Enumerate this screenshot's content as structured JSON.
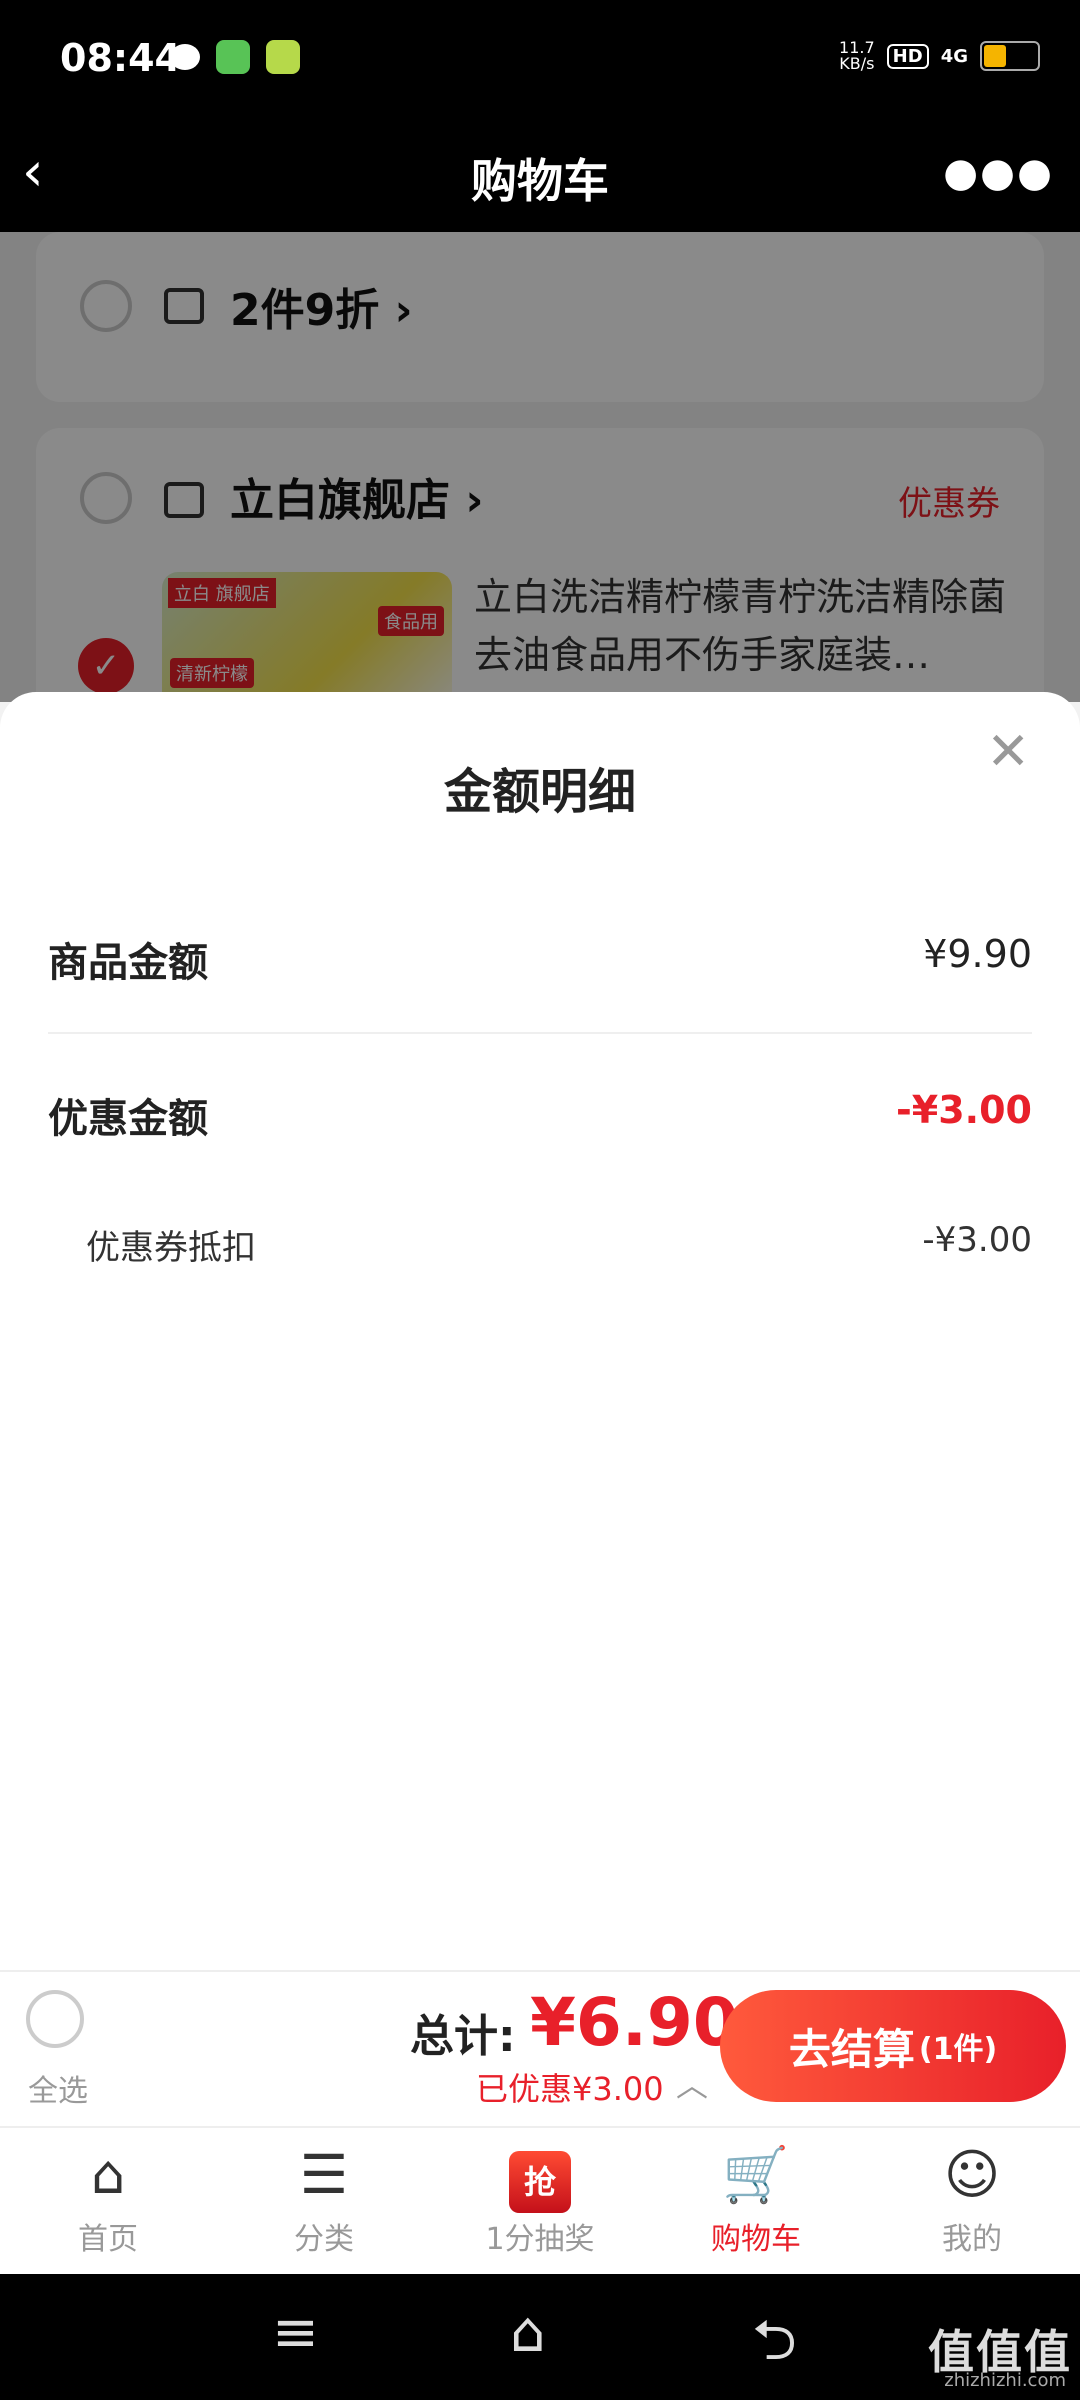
{
  "status_bar": {
    "time": "08:44",
    "net_speed": "11.7\nKB/s",
    "hd": "HD",
    "signal": "4G",
    "battery_color": "#f5b400"
  },
  "header": {
    "back_icon": "chevron-left-icon",
    "title": "购物车",
    "more_icon": "more-dots-icon"
  },
  "cart": {
    "promo": {
      "label": "2件9折"
    },
    "shop": {
      "name": "立白旗舰店",
      "coupon": "优惠券",
      "product_title": "立白洗洁精柠檬青柠洗洁精除菌去油食品用不伤手家庭装…",
      "image_badge_shop": "立白 旗舰店",
      "image_badge_food": "食品用",
      "image_badge_flavor": "清新柠檬"
    }
  },
  "sheet": {
    "title": "金额明细",
    "close_icon": "close-icon",
    "goods_label": "商品金额",
    "goods_value": "¥9.90",
    "discount_label": "优惠金额",
    "discount_value": "-¥3.00",
    "coupon_label": "优惠券抵扣",
    "coupon_value": "-¥3.00"
  },
  "checkout": {
    "select_all": "全选",
    "total_label": "总计:",
    "total_value": "¥6.90",
    "saved": "已优惠¥3.00",
    "button": "去结算",
    "button_count": "(1件)"
  },
  "tabs": [
    {
      "label": "首页",
      "icon": "home-icon"
    },
    {
      "label": "分类",
      "icon": "category-search-icon"
    },
    {
      "label": "1分抽奖",
      "icon": "grab-icon",
      "icon_text": "抢"
    },
    {
      "label": "购物车",
      "icon": "cart-icon"
    },
    {
      "label": "我的",
      "icon": "smile-icon"
    }
  ],
  "watermark": {
    "text": "值值值",
    "sub": "zhizhizhi.com"
  },
  "colors": {
    "accent": "#e8202a",
    "header_bg": "#000000"
  }
}
